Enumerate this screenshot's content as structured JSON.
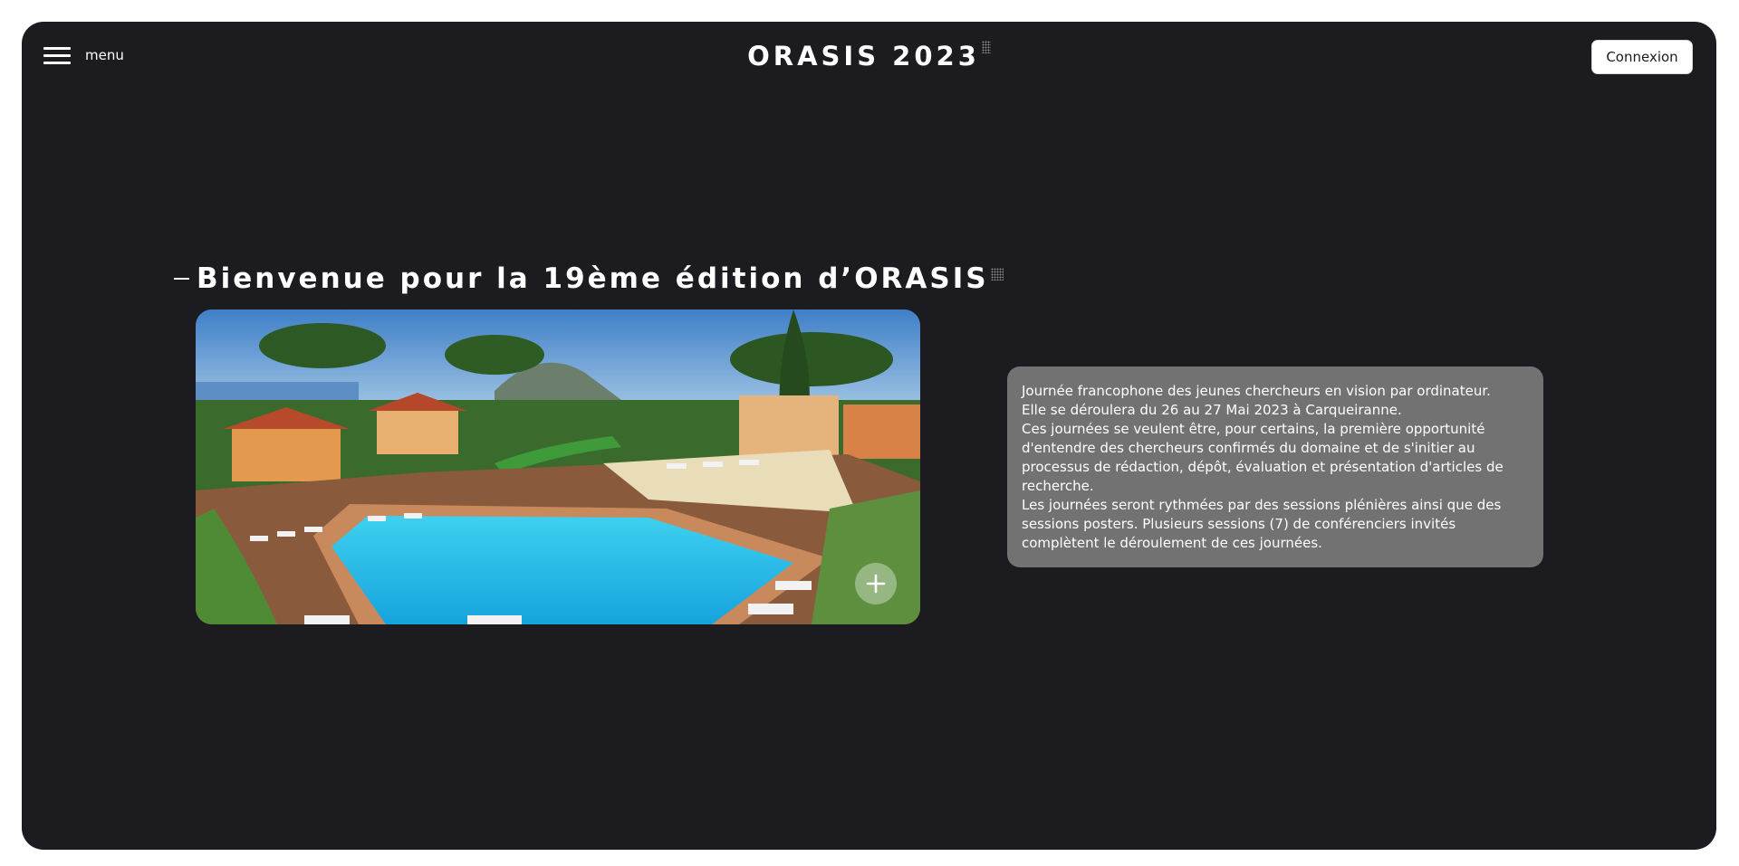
{
  "header": {
    "menu_label": "menu",
    "title": "ORASIS 2023",
    "login_label": "Connexion"
  },
  "main": {
    "heading": "Bienvenue pour la 19ème édition d’ORASIS",
    "image": {
      "plus_icon": "plus-icon"
    },
    "description": [
      "Journée francophone des jeunes chercheurs en vision par ordinateur.",
      "Elle se déroulera du 26 au 27 Mai 2023 à Carqueiranne.",
      "Ces journées se veulent être, pour certains, la première opportunité d'entendre des chercheurs confirmés du domaine et de s'initier au processus de rédaction, dépôt, évaluation et présentation d'articles de recherche.",
      "Les journées seront rythmées par des sessions plénières ainsi que des sessions posters. Plusieurs sessions (7) de conférenciers invités complètent le déroulement de ces journées."
    ]
  },
  "colors": {
    "page_bg": "#ffffff",
    "frame_bg": "#1c1b20",
    "card_bg": "#727272",
    "text": "#ffffff"
  }
}
